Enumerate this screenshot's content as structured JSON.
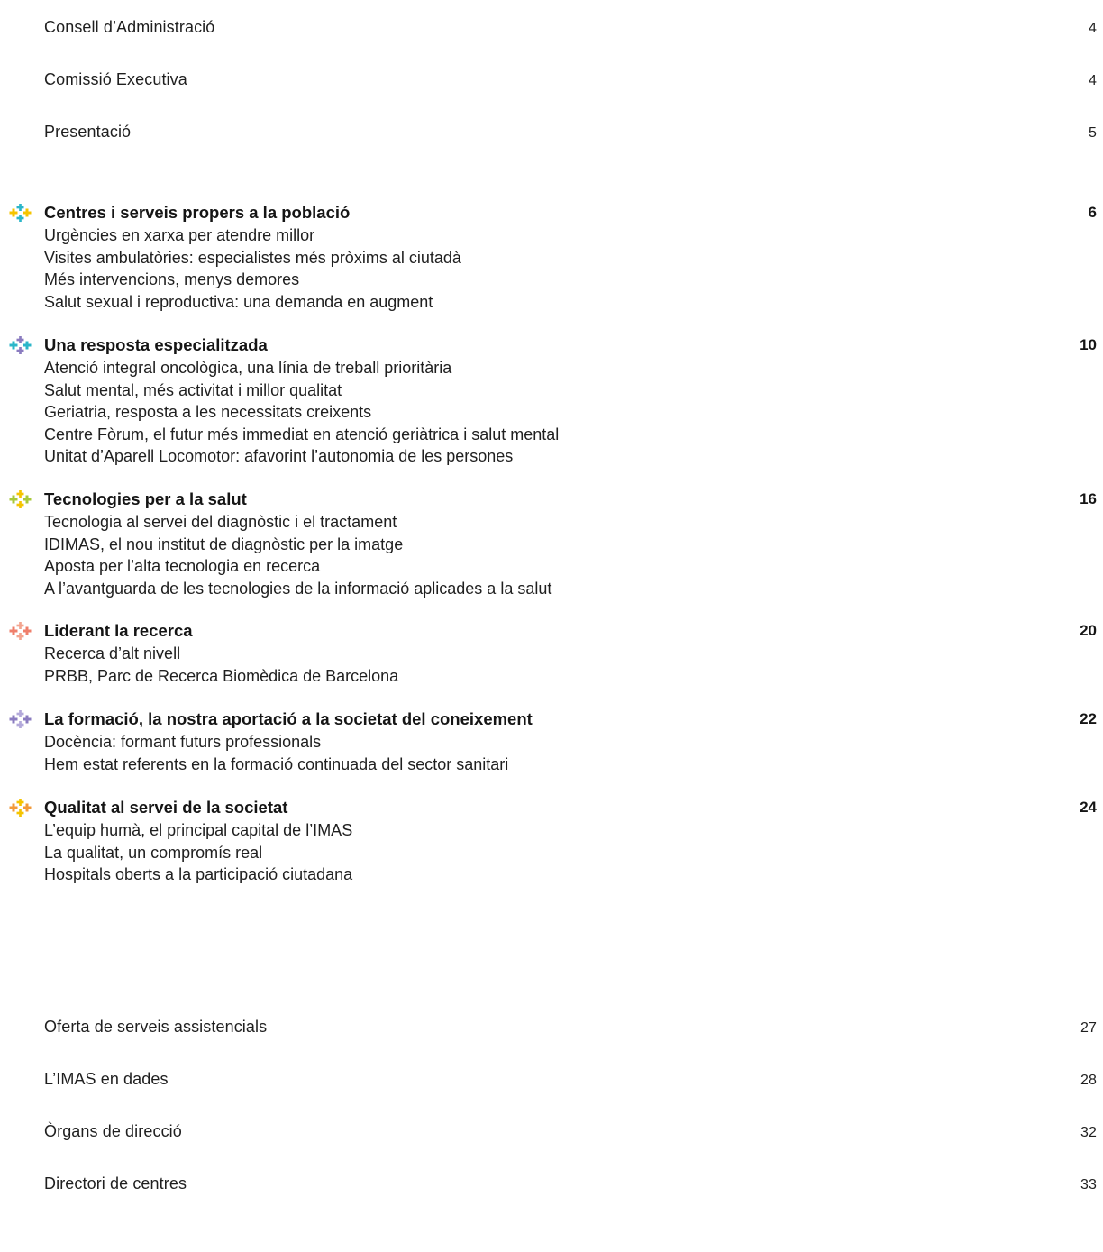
{
  "front": [
    {
      "title": "Consell d’Administració",
      "page": "4"
    },
    {
      "title": "Comissió Executiva",
      "page": "4"
    },
    {
      "title": "Presentació",
      "page": "5"
    }
  ],
  "sections": [
    {
      "title": "Centres i serveis propers a la població",
      "page": "6",
      "icon": "cross-cluster-icon",
      "colors": {
        "a": "#f5c400",
        "b": "#2bb6c9"
      },
      "items": [
        "Urgències en xarxa per atendre millor",
        "Visites ambulatòries: especialistes més pròxims al ciutadà",
        "Més intervencions, menys demores",
        "Salut sexual i reproductiva: una demanda en augment"
      ]
    },
    {
      "title": "Una resposta especialitzada",
      "page": "10",
      "icon": "cross-cluster-icon",
      "colors": {
        "a": "#2bb6c9",
        "b": "#8b7cc0"
      },
      "items": [
        "Atenció integral oncològica, una línia de treball prioritària",
        "Salut mental, més activitat i millor qualitat",
        "Geriatria, resposta a les necessitats creixents",
        "Centre Fòrum, el futur més immediat en atenció geriàtrica i salut mental",
        "Unitat d’Aparell Locomotor: afavorint l’autonomia de les persones"
      ]
    },
    {
      "title": "Tecnologies per a la salut",
      "page": "16",
      "icon": "cross-cluster-icon",
      "colors": {
        "a": "#a8c93a",
        "b": "#f5c400"
      },
      "items": [
        "Tecnologia al servei del diagnòstic i el tractament",
        "IDIMAS, el nou institut de diagnòstic per la imatge",
        "Aposta per l’alta tecnologia en recerca",
        "A l’avantguarda de les tecnologies de la informació aplicades a la salut"
      ]
    },
    {
      "title": "Liderant la recerca",
      "page": "20",
      "icon": "cross-cluster-icon",
      "colors": {
        "a": "#ef7f6b",
        "b": "#f3a58f"
      },
      "items": [
        "Recerca d’alt nivell",
        "PRBB, Parc de Recerca Biomèdica de Barcelona"
      ]
    },
    {
      "title": "La formació, la nostra aportació a la societat del coneixement",
      "page": "22",
      "icon": "cross-cluster-icon",
      "colors": {
        "a": "#8b7cc0",
        "b": "#b3a9da"
      },
      "items": [
        "Docència: formant futurs professionals",
        "Hem estat referents en la formació continuada del sector sanitari"
      ]
    },
    {
      "title": "Qualitat al servei de la societat",
      "page": "24",
      "icon": "cross-cluster-icon",
      "colors": {
        "a": "#f29a3a",
        "b": "#f5c400"
      },
      "items": [
        "L’equip humà, el principal capital de l’IMAS",
        "La qualitat, un compromís real",
        "Hospitals oberts a la participació ciutadana"
      ]
    }
  ],
  "back": [
    {
      "title": "Oferta de serveis assistencials",
      "page": "27"
    },
    {
      "title": "L’IMAS en dades",
      "page": "28"
    },
    {
      "title": "Òrgans de direcció",
      "page": "32"
    },
    {
      "title": "Directori de centres",
      "page": "33"
    }
  ]
}
